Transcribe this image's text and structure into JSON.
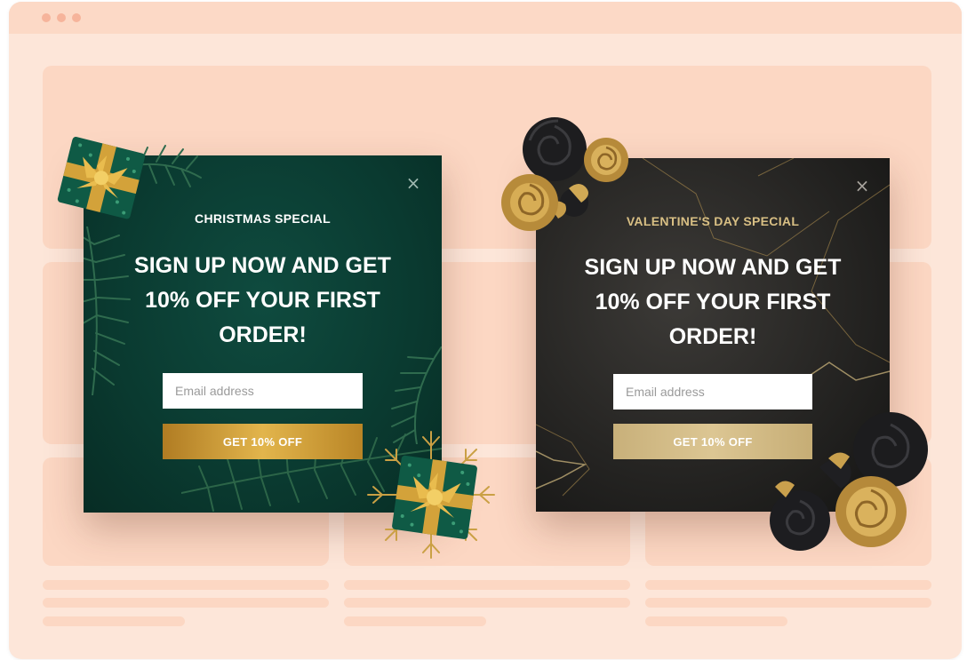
{
  "colors": {
    "window_bg": "#fde6d9",
    "titlebar_bg": "#fcd9c6",
    "placeholder_blocks": "#fcd7c3",
    "xmas_bg": "#0a3a30",
    "xmas_gold": "#d9a93c",
    "valentine_bg": "#262523",
    "valentine_gold": "#d8bf84"
  },
  "popups": {
    "christmas": {
      "eyebrow": "CHRISTMAS SPECIAL",
      "headline_lines": [
        "SIGN UP NOW AND GET",
        "10% OFF YOUR FIRST",
        "ORDER!"
      ],
      "email_placeholder": "Email address",
      "cta_label": "GET 10% OFF",
      "close_glyph": "×",
      "decorations": [
        "gift-box-icon",
        "pine-branch-icon",
        "gold-snowflake-icon"
      ]
    },
    "valentine": {
      "eyebrow": "VALENTINE'S DAY SPECIAL",
      "headline_lines": [
        "SIGN UP NOW AND GET",
        "10% OFF YOUR FIRST",
        "ORDER!"
      ],
      "email_placeholder": "Email address",
      "cta_label": "GET 10% OFF",
      "close_glyph": "×",
      "decorations": [
        "black-rose-icon",
        "gold-rose-icon",
        "heart-icon"
      ]
    }
  }
}
